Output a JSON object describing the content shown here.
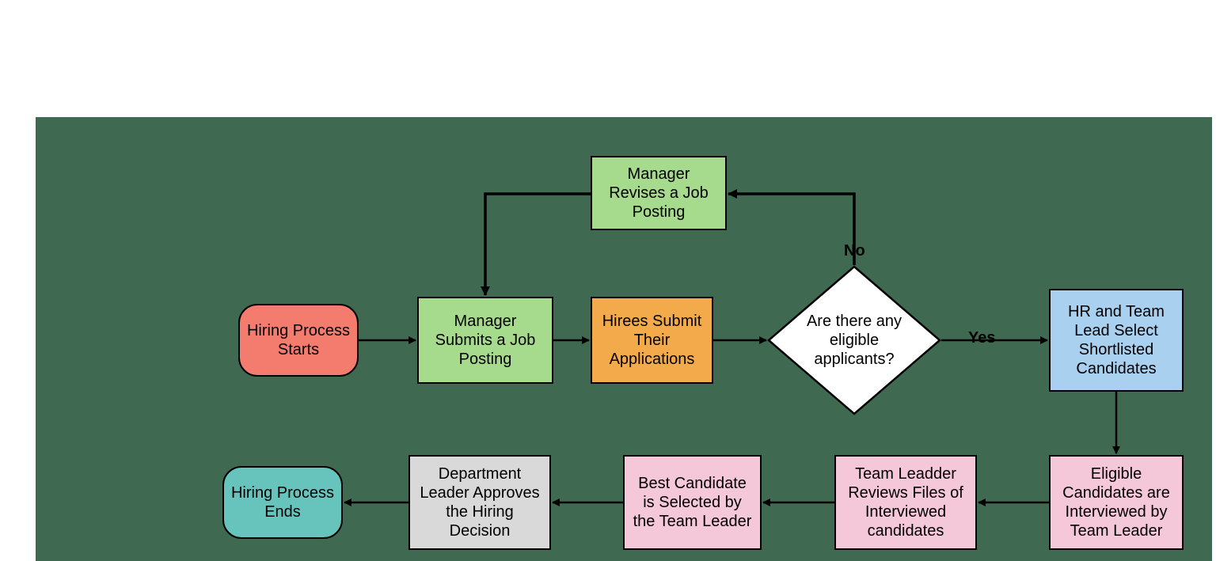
{
  "colors": {
    "start": "#f37c6e",
    "end": "#67c4bd",
    "green": "#a6da8d",
    "orange": "#f3aa4b",
    "blue": "#a9d1ef",
    "pink": "#f4c7d9",
    "grey": "#d9d9d9",
    "decision": "#ffffff"
  },
  "nodes": {
    "start": "Hiring Process Starts",
    "submit": "Manager Submits a Job Posting",
    "revise": "Manager Revises a Job Posting",
    "hirees": "Hirees Submit Their Applications",
    "decision": "Are there any eligible applicants?",
    "shortlist": "HR and Team Lead Select Shortlisted Candidates",
    "interview": "Eligible Candidates are Interviewed by Team Leader",
    "review": "Team Leadder Reviews  Files of Interviewed candidates",
    "best": "Best Candidate is Selected by the Team Leader",
    "approve": "Department Leader Approves the Hiring Decision",
    "end": "Hiring Process Ends"
  },
  "edges": {
    "no": "No",
    "yes": "Yes"
  }
}
